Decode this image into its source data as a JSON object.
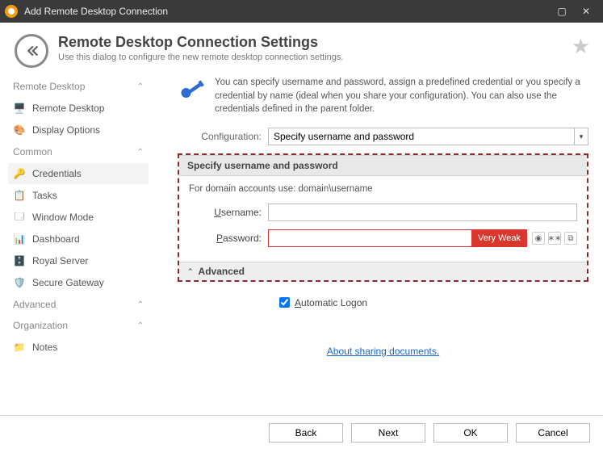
{
  "window": {
    "title": "Add Remote Desktop Connection"
  },
  "header": {
    "title": "Remote Desktop Connection Settings",
    "subtitle": "Use this dialog to configure the new remote desktop connection settings."
  },
  "sidebar": {
    "groups": {
      "remote_desktop": {
        "label": "Remote Desktop"
      },
      "common": {
        "label": "Common"
      },
      "advanced": {
        "label": "Advanced"
      },
      "organization": {
        "label": "Organization"
      }
    },
    "items": {
      "remote_desktop": "Remote Desktop",
      "display_options": "Display Options",
      "credentials": "Credentials",
      "tasks": "Tasks",
      "window_mode": "Window Mode",
      "dashboard": "Dashboard",
      "royal_server": "Royal Server",
      "secure_gateway": "Secure Gateway",
      "notes": "Notes"
    }
  },
  "intro": {
    "text": "You can specify username and password, assign a predefined credential or you specify a credential by name (ideal when you share your configuration). You can also use the credentials defined in the parent folder."
  },
  "config": {
    "label": "Configuration:",
    "value": "Specify username and password"
  },
  "section": {
    "title": "Specify username and password",
    "hint": "For domain accounts use: domain\\username",
    "username_label": "Username:",
    "username_value": "",
    "password_label": "Password:",
    "password_value": "",
    "password_strength": "Very Weak",
    "advanced_label": "Advanced"
  },
  "auto_logon": {
    "label": "Automatic Logon",
    "checked": true
  },
  "link": {
    "text": "About sharing documents."
  },
  "footer": {
    "back": "Back",
    "next": "Next",
    "ok": "OK",
    "cancel": "Cancel"
  },
  "colors": {
    "accent_red": "#d9362e",
    "dashed_border": "#8b2a2a",
    "link": "#1a66cc"
  }
}
